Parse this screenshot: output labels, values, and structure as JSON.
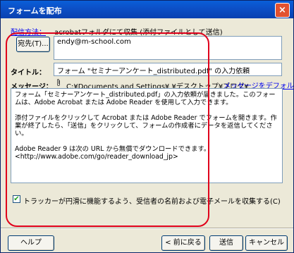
{
  "window": {
    "title": "フォームを配布",
    "close_glyph": "×"
  },
  "method": {
    "link": "配信方法：",
    "value": "acrobatフォルダにて収集 (添付ファイルとして送信)"
  },
  "to": {
    "button_label": "宛先(T)...",
    "value": "endy@m-school.com"
  },
  "title_field": {
    "label": "タイトル：",
    "value": "フォーム \"セミナーアンケート_distributed.pdf\" の入力依頼"
  },
  "message": {
    "label": "メッセージ：",
    "attachment_path": "C:¥Documents and Settings¥     ¥デスクトップ¥ブログ¥...",
    "default_link": "メッセージをデフォルトにリセット",
    "body": "フォーム「セミナーアンケート_distributed.pdf」の入力依頼が届きました。このフォームは、Adobe Acrobat または Adobe Reader を使用して入力できます。\n\n添付ファイルをクリックして Acrobat または Adobe Reader でフォームを開きます。作業が終了したら、「送信」をクリックして、フォームの作成者にデータを返信してください。\n\nAdobe Reader 9 は次の URL から無償でダウンロードできます。\n<http://www.adobe.com/go/reader_download_jp>"
  },
  "tracker": {
    "checked": true,
    "label": "トラッカーが円滑に機能するよう、受信者の名前および電子メールを収集する(C)"
  },
  "footer": {
    "help": "ヘルプ",
    "back": "< 前に戻る",
    "send": "送信",
    "cancel": "キャンセル"
  },
  "colors": {
    "highlight_border": "#e0001b",
    "titlebar": "#0c4fc6",
    "link": "#0000ee"
  }
}
